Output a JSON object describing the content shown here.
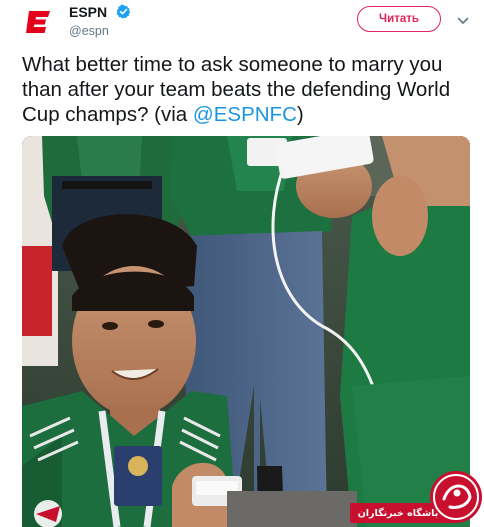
{
  "account": {
    "display_name": "ESPN",
    "handle": "@espn",
    "verified": true,
    "avatar_icon": "espn-logo-icon",
    "brand_color": "#e2001a"
  },
  "actions": {
    "follow_label": "Читать",
    "more_icon": "chevron-down-icon"
  },
  "tweet": {
    "text_before": "What better time to ask someone to marry you than after your team beats the defending World Cup champs? (via ",
    "mention": "@ESPNFC",
    "text_after": ")"
  },
  "media": {
    "type": "video-still",
    "corner_logo_icon": "broadcaster-logo-icon"
  },
  "watermark": {
    "text": "باشگاه خبرنگاران",
    "logo_icon": "yjc-logo-icon",
    "color": "#c8102e"
  }
}
